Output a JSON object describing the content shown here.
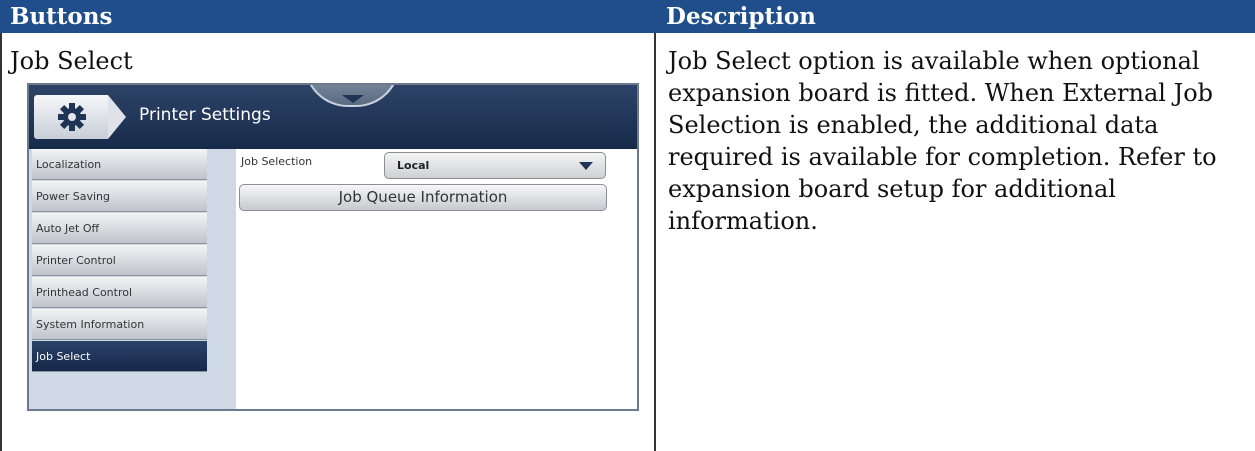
{
  "table": {
    "header_left": "Buttons",
    "header_right": "Description",
    "row_title": "Job Select",
    "description": "Job Select option is available when optional expansion board is fitted. When External Job Selection is enabled, the additional data required is available for completion. Refer to expansion board setup for additional information."
  },
  "screen": {
    "title": "Printer Settings",
    "sidebar": [
      {
        "label": "Localization",
        "active": false
      },
      {
        "label": "Power Saving",
        "active": false
      },
      {
        "label": "Auto Jet Off",
        "active": false
      },
      {
        "label": "Printer Control",
        "active": false
      },
      {
        "label": "Printhead Control",
        "active": false
      },
      {
        "label": "System Information",
        "active": false
      },
      {
        "label": "Job Select",
        "active": true
      }
    ],
    "job_selection_label": "Job Selection",
    "job_selection_value": "Local",
    "queue_button": "Job Queue Information"
  },
  "colors": {
    "header_bg": "#1f4e8a",
    "topbar": "#1f3556",
    "active_item": "#20365a"
  }
}
